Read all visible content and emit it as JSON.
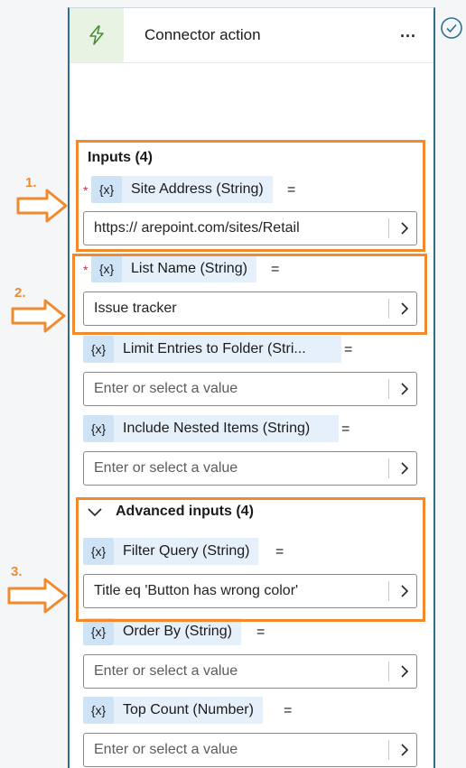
{
  "header": {
    "title": "Connector action",
    "more_label": "...",
    "check_icon": "checkmark-circle-icon",
    "action_icon": "lightning-icon"
  },
  "inputs": {
    "section_title": "Inputs (4)",
    "var_icon": "{x}",
    "eq": "=",
    "params": [
      {
        "name": "Site Address (String)",
        "value": "https://              arepoint.com/sites/Retail",
        "required": "*"
      },
      {
        "name": "List Name (String)",
        "value": "Issue tracker",
        "required": "*"
      },
      {
        "name": "Limit Entries to Folder (Stri...",
        "placeholder": "Enter or select a value"
      },
      {
        "name": "Include Nested Items (String)",
        "placeholder": "Enter or select a value"
      }
    ]
  },
  "advanced": {
    "section_title": "Advanced inputs (4)",
    "params": [
      {
        "name": "Filter Query (String)",
        "value": "Title eq 'Button has wrong color'"
      },
      {
        "name": "Order By (String)",
        "placeholder": "Enter or select a value"
      },
      {
        "name": "Top Count (Number)",
        "placeholder": "Enter or select a value"
      }
    ]
  },
  "annotations": {
    "one": "1.",
    "two": "2.",
    "three": "3."
  },
  "colors": {
    "annotation": "#f08a2c",
    "chip": "#cfe3f6",
    "accent": "#2f6e8e"
  }
}
